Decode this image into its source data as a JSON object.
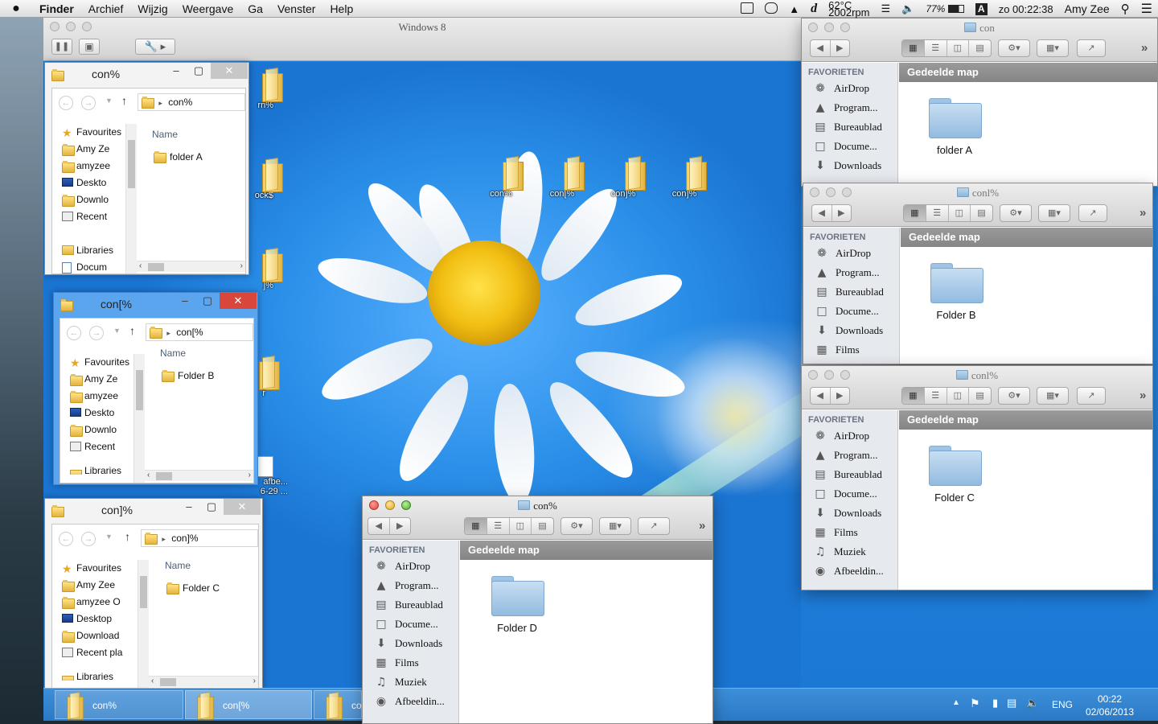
{
  "menubar": {
    "apple": "",
    "app": "Finder",
    "menus": [
      "Archief",
      "Wijzig",
      "Weergave",
      "Ga",
      "Venster",
      "Help"
    ],
    "temp": "62°C",
    "rpm": "2002rpm",
    "battery": "77%",
    "input_source": "A",
    "clock": "zo 00:22:38",
    "user": "Amy Zee"
  },
  "vm": {
    "title": "Windows 8"
  },
  "desktop": {
    "icons": [
      "con%",
      "con[%",
      "con]%",
      "con]%"
    ],
    "partial_labels": [
      "rn%",
      "ock$",
      "]%",
      "r",
      "afbe...",
      "6-29 ..."
    ]
  },
  "explorer_a": {
    "title": "con%",
    "address": "con%",
    "nav": [
      "Favourites",
      "Amy Ze",
      "amyzee",
      "Deskto",
      "Downlo",
      "Recent",
      "Libraries",
      "Docum"
    ],
    "column": "Name",
    "files": [
      "folder A"
    ]
  },
  "explorer_b": {
    "title": "con[%",
    "address": "con[%",
    "nav": [
      "Favourites",
      "Amy Ze",
      "amyzee",
      "Deskto",
      "Downlo",
      "Recent",
      "Libraries"
    ],
    "column": "Name",
    "files": [
      "Folder B"
    ]
  },
  "explorer_c": {
    "title": "con]%",
    "address": "con]%",
    "nav": [
      "Favourites",
      "Amy Zee",
      "amyzee O",
      "Desktop",
      "Download",
      "Recent pla",
      "Libraries"
    ],
    "column": "Name",
    "files": [
      "Folder C"
    ]
  },
  "taskbar": {
    "buttons": [
      "con%",
      "con[%",
      "co"
    ],
    "lang": "ENG",
    "time": "00:22",
    "date": "02/06/2013"
  },
  "finder_common": {
    "sidebar_header": "FAVORIETEN",
    "shared_header": "Gedeelde map"
  },
  "finder_1": {
    "title": "con",
    "sidebar": [
      "AirDrop",
      "Program...",
      "Bureaublad",
      "Docume...",
      "Downloads"
    ],
    "folder": "folder A"
  },
  "finder_2": {
    "title": "conl%",
    "sidebar": [
      "AirDrop",
      "Program...",
      "Bureaublad",
      "Docume...",
      "Downloads",
      "Films"
    ],
    "folder": "Folder B"
  },
  "finder_3": {
    "title": "conl%",
    "sidebar": [
      "AirDrop",
      "Program...",
      "Bureaublad",
      "Docume...",
      "Downloads",
      "Films",
      "Muziek",
      "Afbeeldin..."
    ],
    "folder": "Folder C"
  },
  "finder_4": {
    "title": "con%",
    "sidebar": [
      "AirDrop",
      "Program...",
      "Bureaublad",
      "Docume...",
      "Downloads",
      "Films",
      "Muziek",
      "Afbeeldin..."
    ],
    "folder": "Folder D"
  },
  "colors": {
    "win8_blue": "#1f7fd8",
    "taskbar": "#2b79c6",
    "win_close_red": "#d9473c",
    "mac_sidebar": "#e6e9ee",
    "mac_header_gray": "#8f8f8f"
  }
}
